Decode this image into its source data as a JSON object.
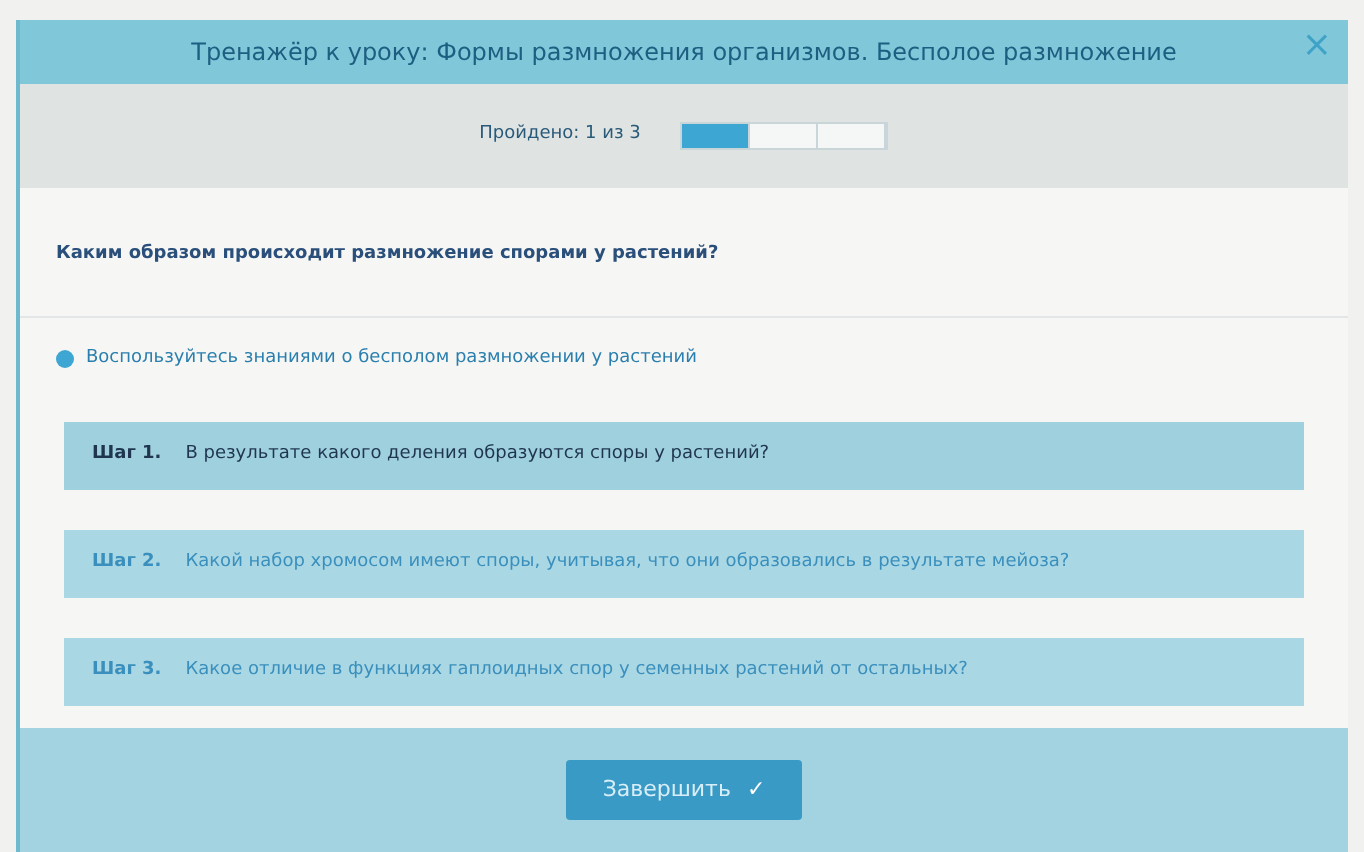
{
  "window": {
    "title": "Тренажёр к уроку: Формы размножения организмов. Бесполое размножение",
    "close": "×"
  },
  "progress": {
    "label": "Пройдено: 1 из 3",
    "segments": [
      {
        "filled": true
      },
      {
        "filled": false
      },
      {
        "filled": false
      }
    ]
  },
  "question": "Каким образом происходит размножение спорами у растений?",
  "hint": "Воспользуйтесь знаниями о бесполом размножении у растений",
  "steps": [
    {
      "label": "Шаг 1.",
      "text": "В результате какого деления образуются споры у растений?",
      "selected": true
    },
    {
      "label": "Шаг 2.",
      "text": "Какой набор хромосом имеют споры, учитывая, что они образовались в результате мейоза?",
      "selected": false
    },
    {
      "label": "Шаг 3.",
      "text": "Какое отличие в функциях гаплоидных спор у семенных растений от остальных?",
      "selected": false
    }
  ],
  "finish_button": {
    "label": "Завершить",
    "icon": "✓"
  }
}
